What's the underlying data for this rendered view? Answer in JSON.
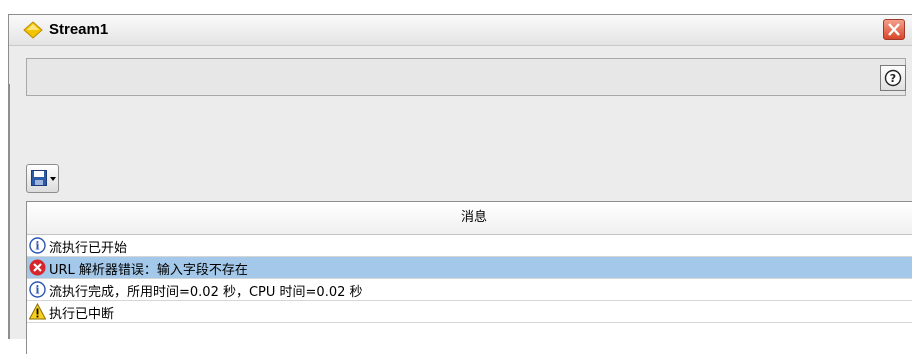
{
  "window": {
    "title": "Stream1",
    "icon": "diamond-icon"
  },
  "toolbar": {
    "help_icon": "help-icon",
    "save_icon": "save-disk-icon",
    "dropdown_icon": "chevron-down-icon"
  },
  "table": {
    "column_header": "消息",
    "rows": [
      {
        "icon": "info-icon",
        "text": "流执行已开始",
        "selected": false
      },
      {
        "icon": "error-icon",
        "text": "URL 解析器错误：输入字段不存在",
        "selected": true
      },
      {
        "icon": "info-icon",
        "text": "流执行完成，所用时间=0.02 秒，CPU 时间=0.02 秒",
        "selected": false
      },
      {
        "icon": "warning-icon",
        "text": "执行已中断",
        "selected": false
      }
    ]
  },
  "colors": {
    "selection": "#a3c8e9",
    "close_red": "#d9472a",
    "diamond_yellow": "#f5c400"
  }
}
